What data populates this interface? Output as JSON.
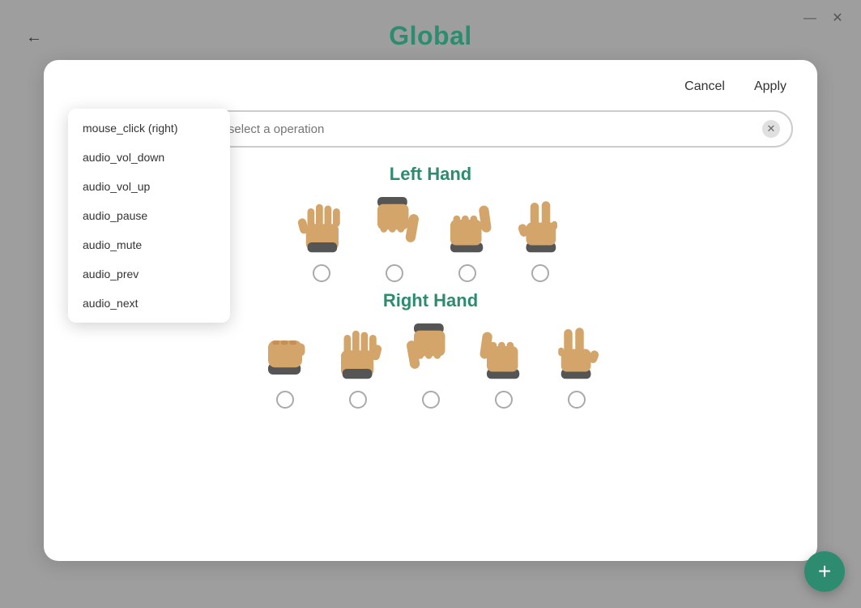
{
  "title": "Global",
  "window": {
    "minimize_label": "—",
    "close_label": "✕",
    "back_label": "←"
  },
  "modal": {
    "cancel_label": "Cancel",
    "apply_label": "Apply",
    "input_placeholder": "Input your shortcut or select a operation"
  },
  "dropdown": {
    "items": [
      "mouse_click (right)",
      "audio_vol_down",
      "audio_vol_up",
      "audio_pause",
      "audio_mute",
      "audio_prev",
      "audio_next"
    ]
  },
  "left_hand": {
    "title": "Left Hand",
    "gestures": [
      {
        "name": "open-palm",
        "emoji": "🖐"
      },
      {
        "name": "thumbs-down",
        "emoji": "👎"
      },
      {
        "name": "thumbs-up",
        "emoji": "👍"
      },
      {
        "name": "victory",
        "emoji": "✌️"
      }
    ]
  },
  "right_hand": {
    "title": "Right Hand",
    "gestures": [
      {
        "name": "fist",
        "emoji": "✊"
      },
      {
        "name": "open-palm",
        "emoji": "🖐"
      },
      {
        "name": "thumbs-down",
        "emoji": "👎"
      },
      {
        "name": "thumbs-up",
        "emoji": "👍"
      },
      {
        "name": "victory",
        "emoji": "✌️"
      }
    ]
  },
  "fab": {
    "label": "+"
  },
  "colors": {
    "accent": "#2d8c70",
    "bg": "#9e9e9e"
  }
}
